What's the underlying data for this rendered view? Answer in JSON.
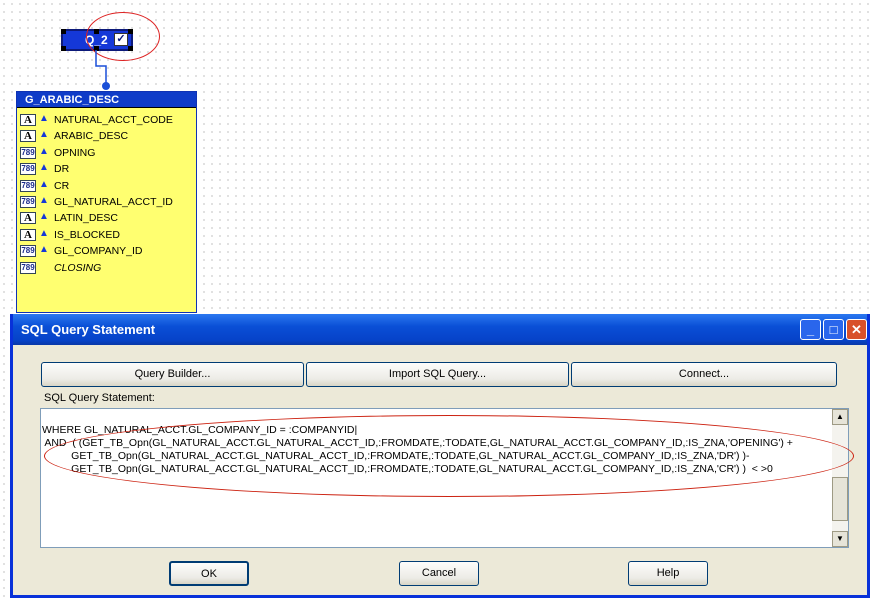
{
  "query_node": {
    "label": "Q_2",
    "edit_icon": "pencil-check-icon"
  },
  "group": {
    "title": "G_ARABIC_DESC",
    "columns": [
      {
        "name": "NATURAL_ACCT_CODE",
        "type": "A"
      },
      {
        "name": "ARABIC_DESC",
        "type": "A"
      },
      {
        "name": "OPNING",
        "type": "789"
      },
      {
        "name": "DR",
        "type": "789"
      },
      {
        "name": "CR",
        "type": "789"
      },
      {
        "name": "GL_NATURAL_ACCT_ID",
        "type": "789"
      },
      {
        "name": "LATIN_DESC",
        "type": "A"
      },
      {
        "name": "IS_BLOCKED",
        "type": "A"
      },
      {
        "name": "GL_COMPANY_ID",
        "type": "789"
      },
      {
        "name": "CLOSING",
        "type": "789"
      }
    ]
  },
  "dialog": {
    "title": "SQL Query Statement",
    "buttons": {
      "query_builder": "Query Builder...",
      "import_sql": "Import SQL Query...",
      "connect": "Connect...",
      "ok": "OK",
      "cancel": "Cancel",
      "help": "Help"
    },
    "sql_label": "SQL Query Statement:",
    "sql_text": "WHERE GL_NATURAL_ACCT.GL_COMPANY_ID = :COMPANYID|\n AND  ( (GET_TB_Opn(GL_NATURAL_ACCT.GL_NATURAL_ACCT_ID,:FROMDATE,:TODATE,GL_NATURAL_ACCT.GL_COMPANY_ID,:IS_ZNA,'OPENING') +\n          GET_TB_Opn(GL_NATURAL_ACCT.GL_NATURAL_ACCT_ID,:FROMDATE,:TODATE,GL_NATURAL_ACCT.GL_COMPANY_ID,:IS_ZNA,'DR') )-\n          GET_TB_Opn(GL_NATURAL_ACCT.GL_NATURAL_ACCT_ID,:FROMDATE,:TODATE,GL_NATURAL_ACCT.GL_COMPANY_ID,:IS_ZNA,'CR') )  < >0"
  }
}
